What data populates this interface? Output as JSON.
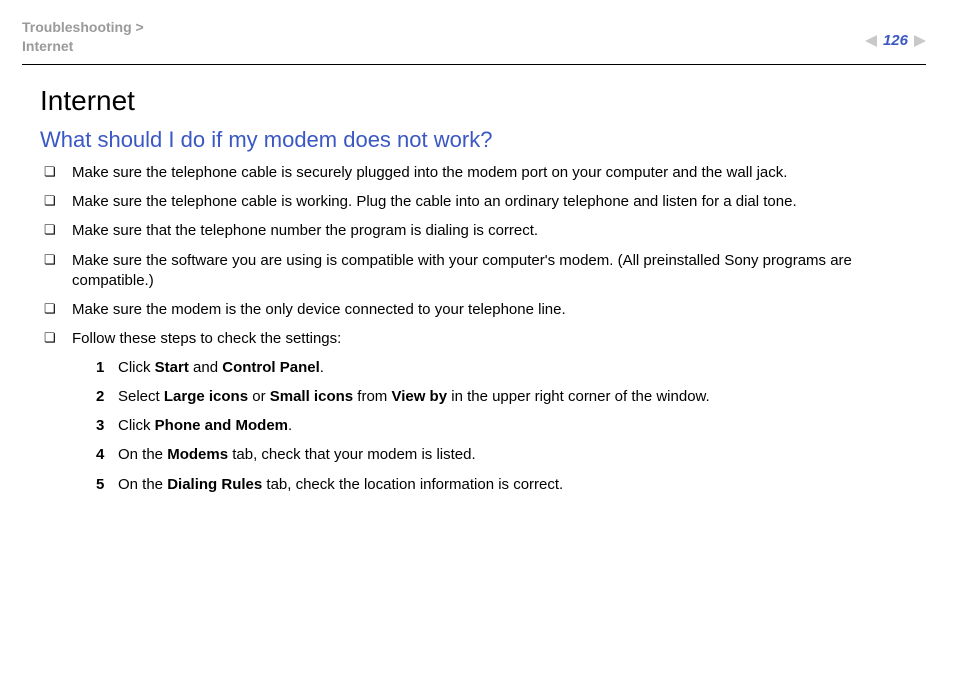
{
  "header": {
    "breadcrumb_parent": "Troubleshooting >",
    "breadcrumb_current": "Internet",
    "page_number": "126"
  },
  "content": {
    "section_title": "Internet",
    "question": "What should I do if my modem does not work?",
    "bullets": [
      "Make sure the telephone cable is securely plugged into the modem port on your computer and the wall jack.",
      "Make sure the telephone cable is working. Plug the cable into an ordinary telephone and listen for a dial tone.",
      "Make sure that the telephone number the program is dialing is correct.",
      "Make sure the software you are using is compatible with your computer's modem. (All preinstalled Sony programs are compatible.)",
      "Make sure the modem is the only device connected to your telephone line.",
      "Follow these steps to check the settings:"
    ],
    "steps": [
      {
        "pre": "Click ",
        "b1": "Start",
        "mid": " and ",
        "b2": "Control Panel",
        "post": "."
      },
      {
        "pre": "Select ",
        "b1": "Large icons",
        "mid": " or ",
        "b2": "Small icons",
        "mid2": " from ",
        "b3": "View by",
        "post": " in the upper right corner of the window."
      },
      {
        "pre": "Click ",
        "b1": "Phone and Modem",
        "post": "."
      },
      {
        "pre": "On the ",
        "b1": "Modems",
        "post": " tab, check that your modem is listed."
      },
      {
        "pre": "On the ",
        "b1": "Dialing Rules",
        "post": " tab, check the location information is correct."
      }
    ]
  }
}
